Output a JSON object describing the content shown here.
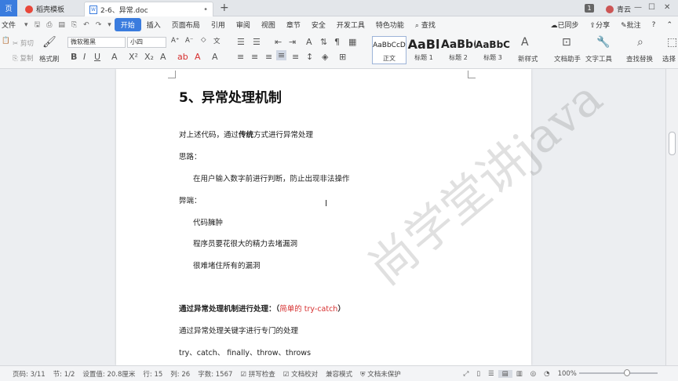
{
  "titlebar": {
    "home_tab": "页",
    "template_tab": "稻壳模板",
    "doc_tab": "2-6、异常.doc",
    "doc_icon": "W",
    "badge_count": "1",
    "user_name": "青云"
  },
  "menu": {
    "file": "文件",
    "items": [
      "开始",
      "插入",
      "页面布局",
      "引用",
      "审阅",
      "视图",
      "章节",
      "安全",
      "开发工具",
      "特色功能"
    ],
    "search": "查找",
    "sync": "已同步",
    "share": "分享",
    "comment": "批注"
  },
  "ribbon": {
    "cut": "剪切",
    "copy": "复制",
    "format_painter": "格式刷",
    "font_name": "微软雅黑",
    "font_size": "小四",
    "styles": [
      {
        "preview": "AaBbCcD",
        "label": "正文"
      },
      {
        "preview": "AaBl",
        "label": "标题 1"
      },
      {
        "preview": "AaBb(",
        "label": "标题 2"
      },
      {
        "preview": "AaBbC",
        "label": "标题 3"
      }
    ],
    "new_style": "新样式",
    "doc_helper": "文档助手",
    "text_tool": "文字工具",
    "find_replace": "查找替换",
    "select": "选择"
  },
  "document": {
    "heading": "5、异常处理机制",
    "line1_a": "对上述代码，通过",
    "line1_b": "传统",
    "line1_c": "方式进行异常处理",
    "line2": "思路：",
    "line3": "在用户输入数字前进行判断，防止出现非法操作",
    "line4": "弊端：",
    "line5": "代码臃肿",
    "line6": "程序员要花很大的精力去堵漏洞",
    "line7": "很难堵住所有的漏洞",
    "line8_a": "通过异常处理机制进行处理：",
    "line8_b": "（",
    "line8_c": "简单的 try-catch",
    "line8_d": "）",
    "line9": "通过异常处理关键字进行专门的处理",
    "line10": "try、catch、 finally、throw、throws",
    "watermark": "尚学堂讲java"
  },
  "statusbar": {
    "page_num": "页码: 3/11",
    "section": "节: 1/2",
    "setting": "设置值: 20.8厘米",
    "row": "行: 15",
    "col": "列: 26",
    "word_count": "字数: 1567",
    "spell_check": "拼写检查",
    "doc_proof": "文档校对",
    "compat_mode": "兼容模式",
    "doc_unprotected": "文档未保护",
    "zoom": "100%"
  },
  "colors": {
    "accent": "#3a7cde",
    "red_text": "#d62f2f"
  }
}
